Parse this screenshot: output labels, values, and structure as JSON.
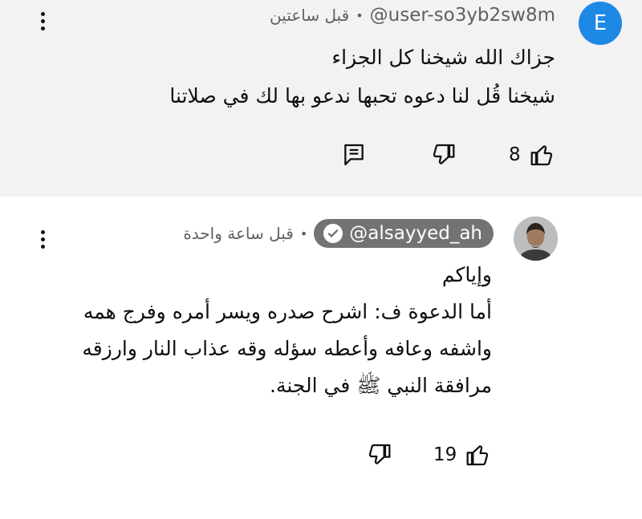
{
  "comment": {
    "avatar_letter": "E",
    "handle": "@user-so3yb2sw8m",
    "time": "قبل ساعتين",
    "separator": "•",
    "lines": [
      "جزاك الله شيخنا كل الجزاء",
      "شيخنا قُل لنا دعوه تحبها ندعو بها لك في صلاتنا"
    ],
    "like_count": "8",
    "avatar_color": "#1e88e5"
  },
  "reply": {
    "handle": "@alsayyed_ah",
    "time": "قبل ساعة واحدة",
    "separator": "•",
    "lines": [
      "وإياكم",
      "أما الدعوة ف: اشرح صدره ويسر أمره وفرج همه",
      "واشفه وعافه وأعطه سؤله وقه عذاب النار وارزقه",
      "مرافقة النبي ﷺ في الجنة."
    ],
    "like_count": "19",
    "badge_color": "#737373"
  }
}
